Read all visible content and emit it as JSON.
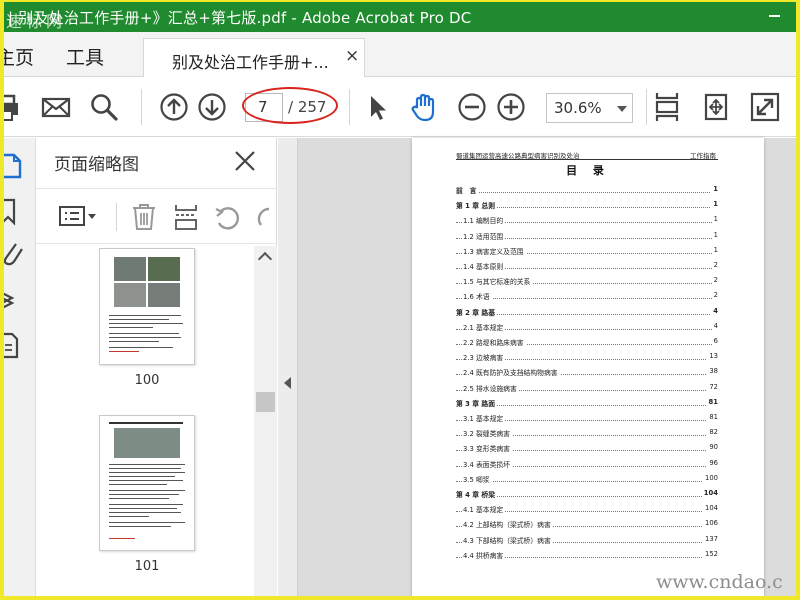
{
  "titlebar": {
    "title": "| 别及处治工作手册+》汇总+第七版.pdf - Adobe Acrobat Pro DC",
    "watermark": "速标网"
  },
  "menubar": {
    "home": "主页",
    "tools": "工具",
    "doc_tab": "别及处治工作手册+...",
    "tab_close": "×"
  },
  "toolbar": {
    "page_current": "7",
    "page_total": "/ 257",
    "zoom": "30.6%",
    "icons": [
      "print-icon",
      "mail-icon",
      "search-icon",
      "prev-page-icon",
      "next-page-icon",
      "select-arrow-icon",
      "hand-tool-icon",
      "zoom-out-icon",
      "zoom-in-icon",
      "fit-page-icon",
      "rotate-view-icon",
      "full-screen-icon"
    ]
  },
  "thumbnails": {
    "title": "页面缩略图",
    "pages": [
      {
        "number": "100"
      },
      {
        "number": "101"
      }
    ]
  },
  "document": {
    "header_left": "蜀道集团运营高速公路典型病害识别及处治",
    "header_right": "工作指南",
    "toc_title": "目 录",
    "toc": [
      {
        "text": "前　言",
        "page": "1",
        "level": "chapter"
      },
      {
        "text": "第 1 章  总则",
        "page": "1",
        "level": "chapter"
      },
      {
        "text": "1.1 编制目的",
        "page": "1",
        "level": "section"
      },
      {
        "text": "1.2 适用范围",
        "page": "1",
        "level": "section"
      },
      {
        "text": "1.3 病害定义及范围",
        "page": "1",
        "level": "section"
      },
      {
        "text": "1.4 基本原则",
        "page": "2",
        "level": "section"
      },
      {
        "text": "1.5 与其它标准的关系",
        "page": "2",
        "level": "section"
      },
      {
        "text": "1.6 术语",
        "page": "2",
        "level": "section"
      },
      {
        "text": "第 2 章  路基",
        "page": "4",
        "level": "chapter"
      },
      {
        "text": "2.1 基本规定",
        "page": "4",
        "level": "section"
      },
      {
        "text": "2.2 路堤和路床病害",
        "page": "6",
        "level": "section"
      },
      {
        "text": "2.3 边坡病害",
        "page": "13",
        "level": "section"
      },
      {
        "text": "2.4 既有防护及支挡结构物病害",
        "page": "38",
        "level": "section"
      },
      {
        "text": "2.5 排水设施病害",
        "page": "72",
        "level": "section"
      },
      {
        "text": "第 3 章  路面",
        "page": "81",
        "level": "chapter"
      },
      {
        "text": "3.1 基本规定",
        "page": "81",
        "level": "section"
      },
      {
        "text": "3.2 裂缝类病害",
        "page": "82",
        "level": "section"
      },
      {
        "text": "3.3 变形类病害",
        "page": "90",
        "level": "section"
      },
      {
        "text": "3.4 表面类损坏",
        "page": "96",
        "level": "section"
      },
      {
        "text": "3.5 唧浆",
        "page": "100",
        "level": "section"
      },
      {
        "text": "第 4 章  桥梁",
        "page": "104",
        "level": "chapter"
      },
      {
        "text": "4.1 基本规定",
        "page": "104",
        "level": "section"
      },
      {
        "text": "4.2 上部结构（梁式桥）病害",
        "page": "106",
        "level": "section"
      },
      {
        "text": "4.3 下部结构（梁式桥）病害",
        "page": "137",
        "level": "section"
      },
      {
        "text": "4.4 拱桥病害",
        "page": "152",
        "level": "section"
      }
    ]
  },
  "site_watermark": "www.cndao.c",
  "colors": {
    "titlebar": "#1f8a2e",
    "accent_blue": "#1f6fd0",
    "highlight_red": "#d9231c",
    "outer_frame": "#f0e92a"
  }
}
